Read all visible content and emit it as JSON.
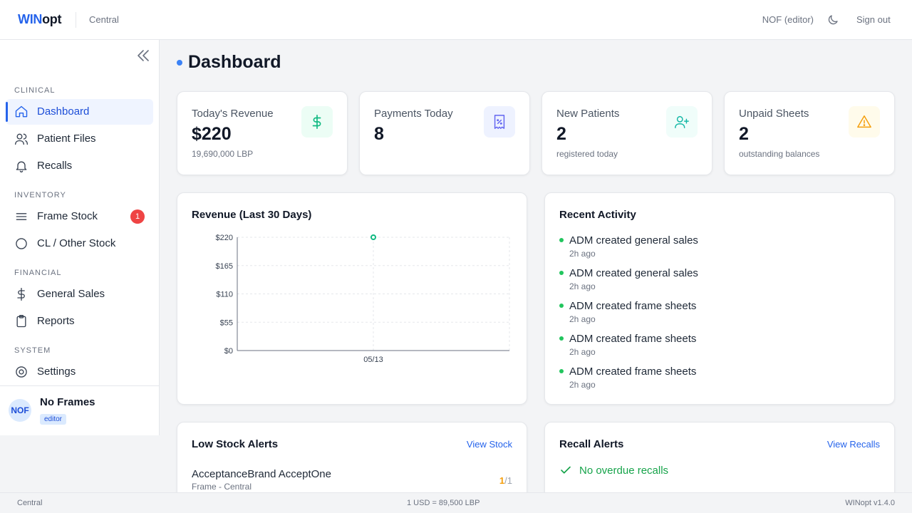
{
  "header": {
    "brand_part1": "WIN",
    "brand_part2": "opt",
    "branch": "Central",
    "user_role": "NOF (editor)",
    "theme_icon": "moon-icon",
    "signout_label": "Sign out"
  },
  "sidebar": {
    "sections": {
      "clinical": "CLINICAL",
      "inventory": "INVENTORY",
      "financial": "FINANCIAL",
      "system": "SYSTEM"
    },
    "items": [
      {
        "label": "Dashboard",
        "icon": "home-icon",
        "active": true
      },
      {
        "label": "Patient Files",
        "icon": "users-icon"
      },
      {
        "label": "Recalls",
        "icon": "bell-icon"
      },
      {
        "label": "Frame Stock",
        "icon": "menu-lines-icon",
        "badge": "1"
      },
      {
        "label": "CL / Other Stock",
        "icon": "circle-icon"
      },
      {
        "label": "General Sales",
        "icon": "dollar-icon"
      },
      {
        "label": "Reports",
        "icon": "clipboard-icon"
      },
      {
        "label": "Settings",
        "icon": "settings-icon"
      }
    ],
    "user": {
      "initials": "NOF",
      "name": "No Frames",
      "role": "editor"
    }
  },
  "main": {
    "title": "Dashboard",
    "stats": [
      {
        "label": "Today's Revenue",
        "value": "$220",
        "sub": "19,690,000 LBP",
        "icon": "dollar-icon",
        "color": "#10b981"
      },
      {
        "label": "Payments Today",
        "value": "8",
        "sub": "",
        "icon": "receipt-icon",
        "color": "#6366f1"
      },
      {
        "label": "New Patients",
        "value": "2",
        "sub": "registered today",
        "icon": "user-plus-icon",
        "color": "#14b8a6"
      },
      {
        "label": "Unpaid Sheets",
        "value": "2",
        "sub": "outstanding balances",
        "icon": "warning-icon",
        "color": "#f59e0b"
      }
    ],
    "revenue_chart": {
      "title": "Revenue (Last 30 Days)"
    },
    "recent_activity": {
      "title": "Recent Activity",
      "items": [
        {
          "text": "ADM created general sales",
          "time": "2h ago"
        },
        {
          "text": "ADM created general sales",
          "time": "2h ago"
        },
        {
          "text": "ADM created frame sheets",
          "time": "2h ago"
        },
        {
          "text": "ADM created frame sheets",
          "time": "2h ago"
        },
        {
          "text": "ADM created frame sheets",
          "time": "2h ago"
        }
      ]
    },
    "low_stock": {
      "title": "Low Stock Alerts",
      "link": "View Stock",
      "items": [
        {
          "name": "AcceptanceBrand AcceptOne",
          "meta": "Frame - Central",
          "qty": "1",
          "qty_total": "/1"
        }
      ]
    },
    "recall_alerts": {
      "title": "Recall Alerts",
      "link": "View Recalls",
      "empty_text": "No overdue recalls"
    }
  },
  "footer": {
    "branch": "Central",
    "exchange_rate": "1 USD = 89,500 LBP",
    "version": "WINopt v1.4.0"
  },
  "chart_data": {
    "type": "line",
    "x": [
      "05/13"
    ],
    "series": [
      {
        "values": [
          220
        ]
      }
    ],
    "ylim": [
      0,
      220
    ],
    "yticks": [
      "$0",
      "$55",
      "$110",
      "$165",
      "$220"
    ],
    "grid": true,
    "color": "#10b981"
  }
}
